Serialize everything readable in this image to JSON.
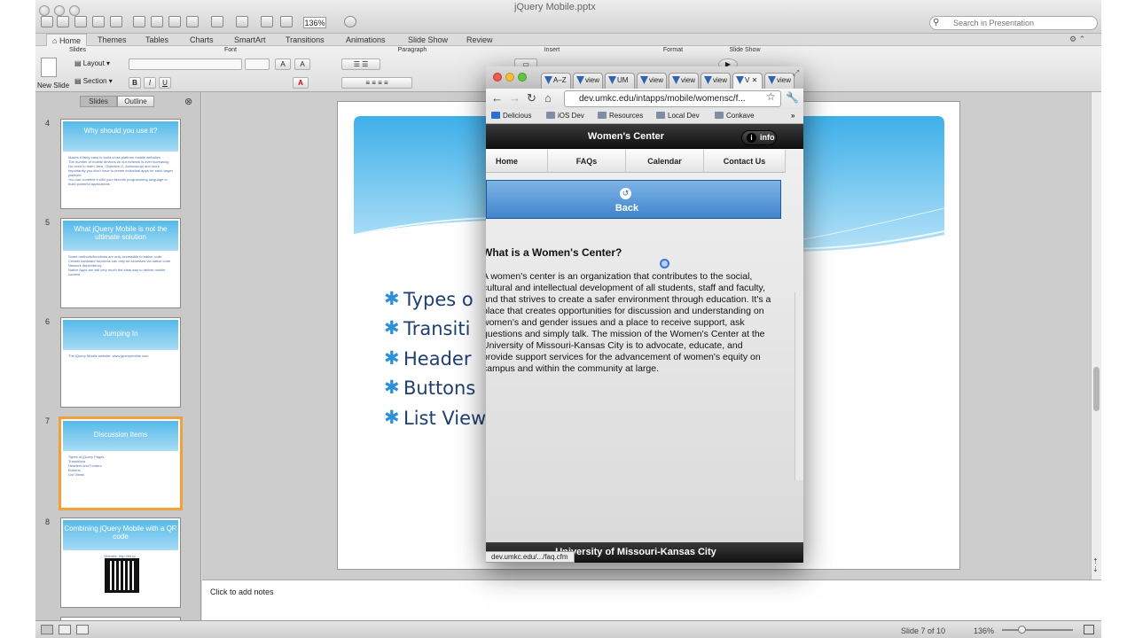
{
  "ppt": {
    "window_title": "jQuery Mobile.pptx",
    "zoom_field": "136%",
    "search_placeholder": "Search in Presentation",
    "ribbon_tabs": [
      "Home",
      "Themes",
      "Tables",
      "Charts",
      "SmartArt",
      "Transitions",
      "Animations",
      "Slide Show",
      "Review"
    ],
    "ribbon_groups": [
      "Slides",
      "Font",
      "Paragraph",
      "Insert",
      "Format",
      "Slide Show"
    ],
    "new_slide_label": "New Slide",
    "layout_label": "Layout",
    "section_label": "Section",
    "slides_tab": "Slides",
    "outline_tab": "Outline",
    "thumbnails": [
      {
        "num": "4",
        "title": "Why should you use it?",
        "bullets": [
          "Makes it fairly easy to build cross platform mobile websites",
          "The number of mobile devices on our network is ever increasing",
          "No need to learn Java, Objective-C, Actionscript and more importantly you don't have to create individual apps for each target platform",
          "You can combine it with your favorite programming language to build powerful applications"
        ]
      },
      {
        "num": "5",
        "title": "What jQuery Mobile is not the ultimate solution",
        "bullets": [
          "Some methods/functions are only accessible to native code",
          "Certain hardware functions can only be accessed via native code",
          "Network dependency",
          "Native Apps are still very much the ideal way to deliver mobile content"
        ]
      },
      {
        "num": "6",
        "title": "Jumping In",
        "bullets": [
          "The jQuery Mobile website: www.jquerymobile.com"
        ]
      },
      {
        "num": "7",
        "title": "Discussion Items",
        "bullets": [
          "Types of jQuery Pages",
          "Transitions",
          "Headers and Footers",
          "Buttons",
          "List Views"
        ]
      },
      {
        "num": "8",
        "title": "Combining jQuery Mobile with a QR code",
        "bullets": [
          "Website: http://bit.ly/..."
        ]
      }
    ],
    "slide_bullets": [
      "Types o",
      "Transiti",
      "Header",
      "Buttons",
      "List View"
    ],
    "notes_placeholder": "Click to add notes",
    "status_slide": "Slide 7 of 10",
    "status_zoom": "136%"
  },
  "browser": {
    "tabs": [
      "A–Z",
      "view",
      "UM",
      "view",
      "view",
      "view",
      "V",
      "view"
    ],
    "url": "dev.umkc.edu/intapps/mobile/womensc/f...",
    "bookmarks": [
      "Delicious",
      "iOS Dev",
      "Resources",
      "Local Dev",
      "Conkave"
    ],
    "status_url": "dev.umkc.edu/.../faq.cfm"
  },
  "mobile_page": {
    "title": "Women's Center",
    "info_label": "info",
    "nav": [
      "Home",
      "FAQs",
      "Calendar",
      "Contact Us"
    ],
    "back_label": "Back",
    "heading": "What is a Women's Center?",
    "body": "A women's center is an organization that contributes to the social, cultural and intellectual development of all students, staff and faculty, and that strives to create a safer environment through education. It's a place that creates opportunities for discussion and understanding on women's and gender issues and a place to receive support, ask questions and simply talk. The mission of the Women's Center at the University of Missouri-Kansas City is to advocate, educate, and provide support services for the advancement of women's equity on campus and within the community at large.",
    "footer": "University of Missouri-Kansas City"
  },
  "colors": {
    "accent": "#2e90d6",
    "selection": "#f2a13a",
    "button_blue": "#3f84cc"
  }
}
